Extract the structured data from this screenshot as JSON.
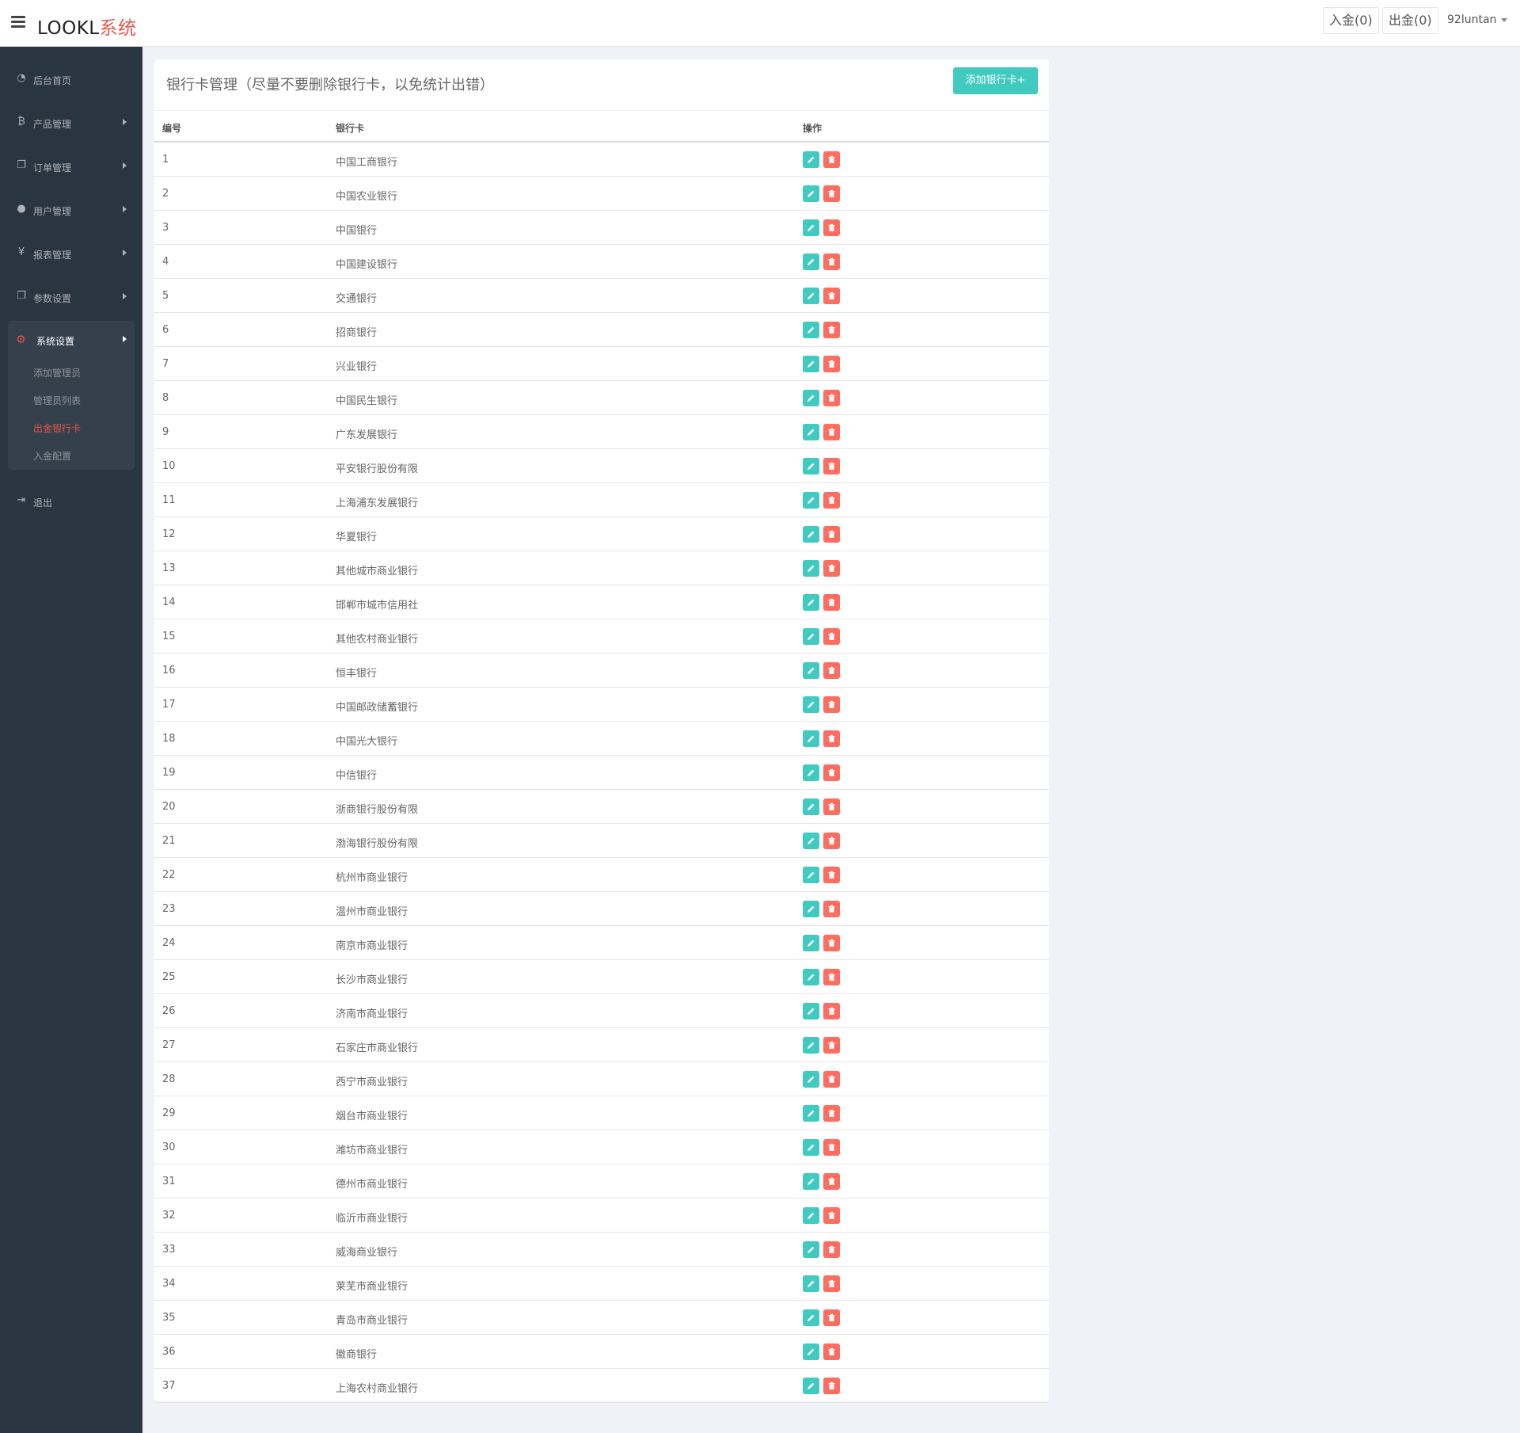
{
  "header": {
    "brand_main": "LOOKL",
    "brand_accent": "系统",
    "deposit_label": "入金(0)",
    "withdraw_label": "出金(0)",
    "username": "92luntan"
  },
  "sidebar": {
    "items": [
      {
        "label": "后台首页",
        "icon": "dashboard-icon"
      },
      {
        "label": "产品管理",
        "icon": "bitcoin-icon"
      },
      {
        "label": "订单管理",
        "icon": "copy-icon"
      },
      {
        "label": "用户管理",
        "icon": "user-icon"
      },
      {
        "label": "报表管理",
        "icon": "yen-icon"
      },
      {
        "label": "参数设置",
        "icon": "copy-icon"
      }
    ],
    "system": {
      "label": "系统设置",
      "icon": "cogs-icon",
      "subitems": [
        "添加管理员",
        "管理员列表",
        "出金银行卡",
        "入金配置"
      ],
      "active_index": 2
    },
    "logout_label": "退出"
  },
  "panel": {
    "title": "银行卡管理（尽量不要删除银行卡，以免统计出错）",
    "add_button": "添加银行卡+"
  },
  "table": {
    "headers": [
      "编号",
      "银行卡",
      "操作"
    ],
    "rows": [
      {
        "id": "1",
        "name": "中国工商银行"
      },
      {
        "id": "2",
        "name": "中国农业银行"
      },
      {
        "id": "3",
        "name": "中国银行"
      },
      {
        "id": "4",
        "name": "中国建设银行"
      },
      {
        "id": "5",
        "name": "交通银行"
      },
      {
        "id": "6",
        "name": "招商银行"
      },
      {
        "id": "7",
        "name": "兴业银行"
      },
      {
        "id": "8",
        "name": "中国民生银行"
      },
      {
        "id": "9",
        "name": "广东发展银行"
      },
      {
        "id": "10",
        "name": "平安银行股份有限"
      },
      {
        "id": "11",
        "name": "上海浦东发展银行"
      },
      {
        "id": "12",
        "name": "华夏银行"
      },
      {
        "id": "13",
        "name": "其他城市商业银行"
      },
      {
        "id": "14",
        "name": "邯郸市城市信用社"
      },
      {
        "id": "15",
        "name": "其他农村商业银行"
      },
      {
        "id": "16",
        "name": "恒丰银行"
      },
      {
        "id": "17",
        "name": "中国邮政储蓄银行"
      },
      {
        "id": "18",
        "name": "中国光大银行"
      },
      {
        "id": "19",
        "name": "中信银行"
      },
      {
        "id": "20",
        "name": "浙商银行股份有限"
      },
      {
        "id": "21",
        "name": "渤海银行股份有限"
      },
      {
        "id": "22",
        "name": "杭州市商业银行"
      },
      {
        "id": "23",
        "name": "温州市商业银行"
      },
      {
        "id": "24",
        "name": "南京市商业银行"
      },
      {
        "id": "25",
        "name": "长沙市商业银行"
      },
      {
        "id": "26",
        "name": "济南市商业银行"
      },
      {
        "id": "27",
        "name": "石家庄市商业银行"
      },
      {
        "id": "28",
        "name": "西宁市商业银行"
      },
      {
        "id": "29",
        "name": "烟台市商业银行"
      },
      {
        "id": "30",
        "name": "潍坊市商业银行"
      },
      {
        "id": "31",
        "name": "德州市商业银行"
      },
      {
        "id": "32",
        "name": "临沂市商业银行"
      },
      {
        "id": "33",
        "name": "威海商业银行"
      },
      {
        "id": "34",
        "name": "莱芜市商业银行"
      },
      {
        "id": "35",
        "name": "青岛市商业银行"
      },
      {
        "id": "36",
        "name": "徽商银行"
      },
      {
        "id": "37",
        "name": "上海农村商业银行"
      }
    ]
  },
  "colors": {
    "accent": "#e8564a",
    "sidebar_bg": "#2a3542",
    "edit_btn": "#41cac0",
    "delete_btn": "#ff6c60"
  }
}
